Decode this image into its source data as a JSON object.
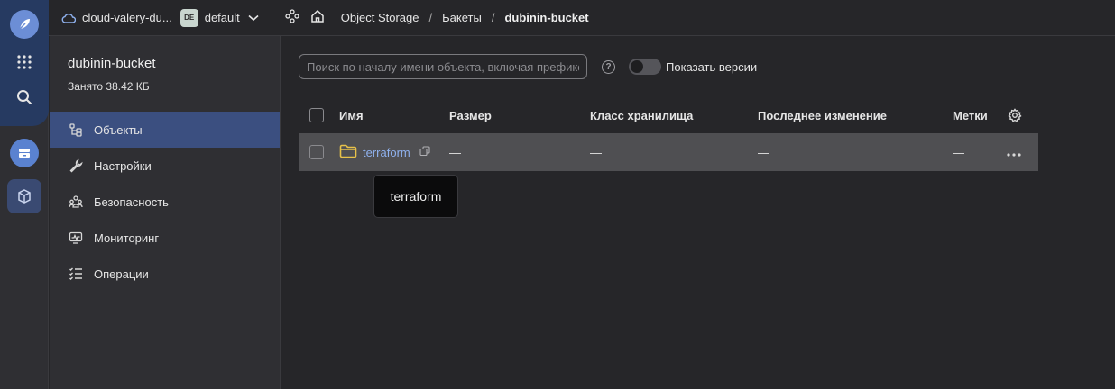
{
  "topbar": {
    "cloud_name": "cloud-valery-du...",
    "folder_badge": "DE",
    "folder_name": "default",
    "breadcrumbs": [
      "Object Storage",
      "Бакеты",
      "dubinin-bucket"
    ],
    "separator": "/"
  },
  "sidebar": {
    "bucket_name": "dubinin-bucket",
    "bucket_usage": "Занято 38.42 КБ",
    "items": [
      {
        "label": "Объекты",
        "icon": "objects-icon",
        "active": true
      },
      {
        "label": "Настройки",
        "icon": "wrench-icon",
        "active": false
      },
      {
        "label": "Безопасность",
        "icon": "users-icon",
        "active": false
      },
      {
        "label": "Мониторинг",
        "icon": "monitor-icon",
        "active": false
      },
      {
        "label": "Операции",
        "icon": "operations-icon",
        "active": false
      }
    ]
  },
  "main": {
    "search": {
      "placeholder": "Поиск по началу имени объекта, включая префикс",
      "value": ""
    },
    "show_versions_label": "Показать версии",
    "show_versions_on": false,
    "table": {
      "columns": [
        "Имя",
        "Размер",
        "Класс хранилища",
        "Последнее изменение",
        "Метки"
      ],
      "rows": [
        {
          "name": "terraform",
          "size": "—",
          "storage_class": "—",
          "modified": "—",
          "tags": "—"
        }
      ]
    },
    "tooltip": "terraform"
  },
  "colors": {
    "accent": "#3b4f80",
    "link": "#8fb1ee",
    "folder_icon": "#e8c24a",
    "background": "#262629"
  }
}
